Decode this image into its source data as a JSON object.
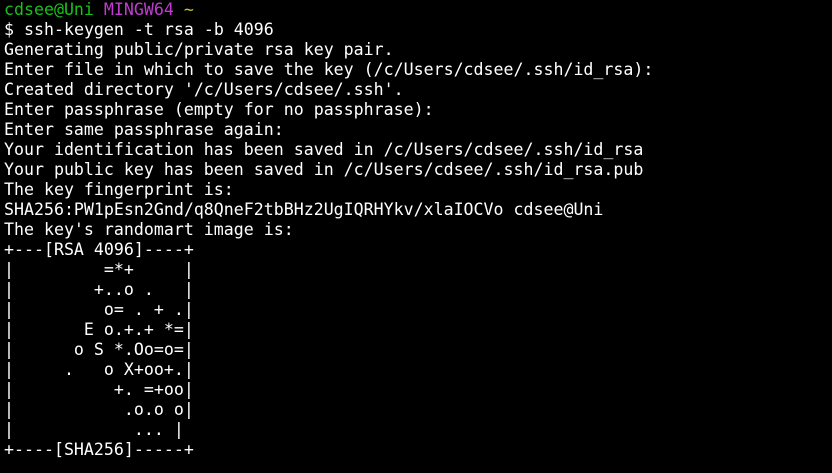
{
  "prompt": {
    "user_host": "cdsee@Uni",
    "system": "MINGW64",
    "cwd": "~",
    "symbol": "$"
  },
  "command": "ssh-keygen -t rsa -b 4096",
  "output": [
    "Generating public/private rsa key pair.",
    "Enter file in which to save the key (/c/Users/cdsee/.ssh/id_rsa):",
    "Created directory '/c/Users/cdsee/.ssh'.",
    "Enter passphrase (empty for no passphrase):",
    "Enter same passphrase again:",
    "Your identification has been saved in /c/Users/cdsee/.ssh/id_rsa",
    "Your public key has been saved in /c/Users/cdsee/.ssh/id_rsa.pub",
    "The key fingerprint is:",
    "SHA256:PW1pEsn2Gnd/q8QneF2tbBHz2UgIQRHYkv/xlaIOCVo cdsee@Uni",
    "The key's randomart image is:",
    "+---[RSA 4096]----+",
    "|         =*+     |",
    "|        +..o .   |",
    "|         o= . + .|",
    "|       E o.+.+ *=|",
    "|      o S *.Oo=o=|",
    "|     .   o X+oo+.|",
    "|          +. =+oo|",
    "|           .o.o o|",
    "|            ... |",
    "+----[SHA256]-----+"
  ],
  "colors": {
    "background": "#000000",
    "text": "#ffffff",
    "user_host": "#17c219",
    "system": "#c13bd2",
    "cwd": "#c7c41d"
  }
}
